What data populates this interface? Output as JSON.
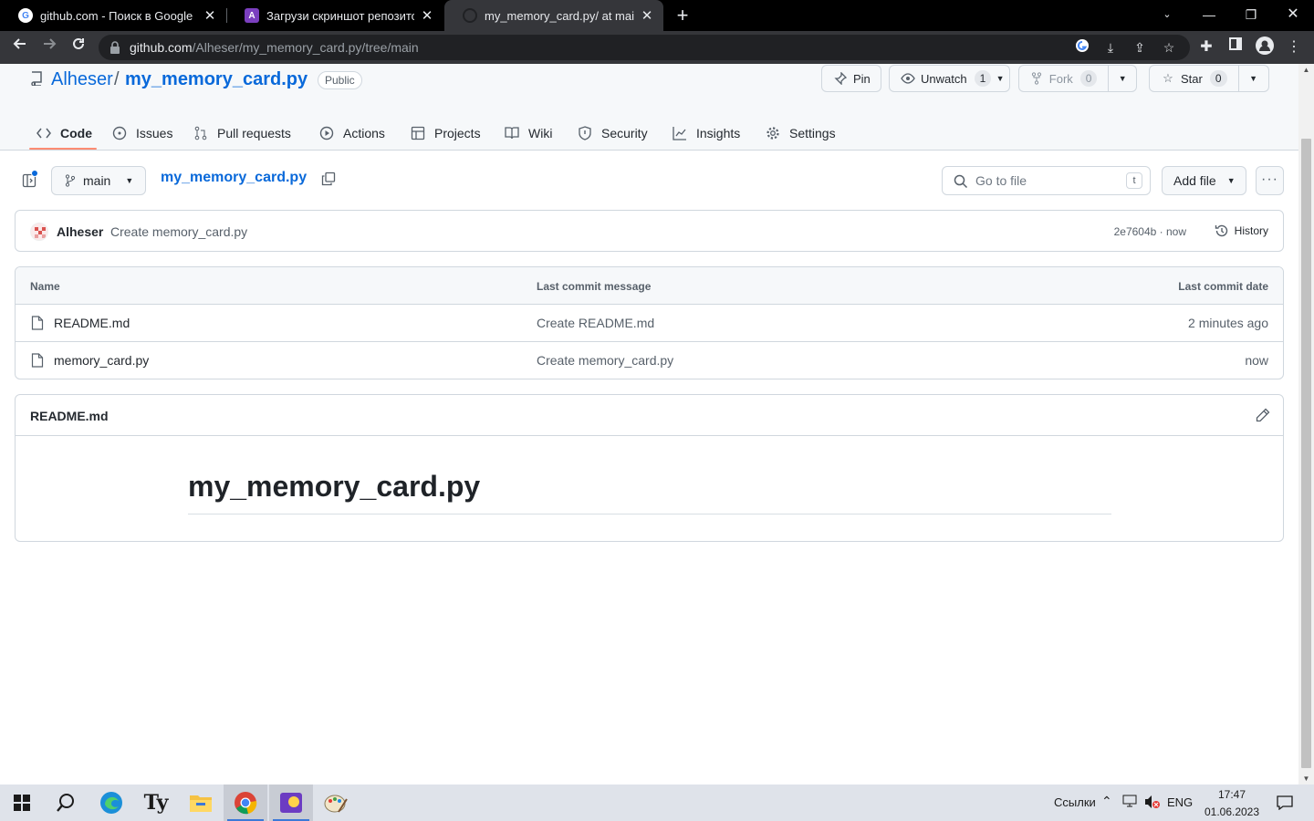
{
  "browser": {
    "tabs": [
      {
        "title": "github.com - Поиск в Google",
        "icon": "google-icon"
      },
      {
        "title": "Загрузи скриншот репозитория",
        "icon": "algorithmics-icon"
      },
      {
        "title": "my_memory_card.py/ at main · Alheser/my_memory_card.py",
        "icon": "github-icon",
        "active": true
      }
    ],
    "url_host": "github.com",
    "url_path": "/Alheser/my_memory_card.py/tree/main"
  },
  "repo": {
    "owner": "Alheser",
    "separator": "/",
    "name": "my_memory_card.py",
    "visibility": "Public",
    "actions": {
      "pin": "Pin",
      "watch": "Unwatch",
      "watch_count": "1",
      "fork": "Fork",
      "fork_count": "0",
      "star": "Star",
      "star_count": "0"
    }
  },
  "nav": {
    "code": "Code",
    "issues": "Issues",
    "pulls": "Pull requests",
    "actions": "Actions",
    "projects": "Projects",
    "wiki": "Wiki",
    "security": "Security",
    "insights": "Insights",
    "settings": "Settings"
  },
  "filebar": {
    "branch": "main",
    "breadcrumb": "my_memory_card.py",
    "goto_placeholder": "Go to file",
    "goto_shortcut": "t",
    "add_file": "Add file",
    "more": "···"
  },
  "commit": {
    "author": "Alheser",
    "message": "Create memory_card.py",
    "meta": "2e7604b · now",
    "history": "History"
  },
  "files": {
    "headers": {
      "name": "Name",
      "message": "Last commit message",
      "date": "Last commit date"
    },
    "rows": [
      {
        "name": "README.md",
        "message": "Create README.md",
        "date": "2 minutes ago"
      },
      {
        "name": "memory_card.py",
        "message": "Create memory_card.py",
        "date": "now"
      }
    ]
  },
  "readme": {
    "title": "README.md",
    "heading": "my_memory_card.py"
  },
  "taskbar": {
    "links": "Ссылки",
    "lang": "ENG",
    "time": "17:47",
    "date": "01.06.2023"
  },
  "colors": {
    "accent": "#0969da",
    "underline": "#fd8c73"
  }
}
